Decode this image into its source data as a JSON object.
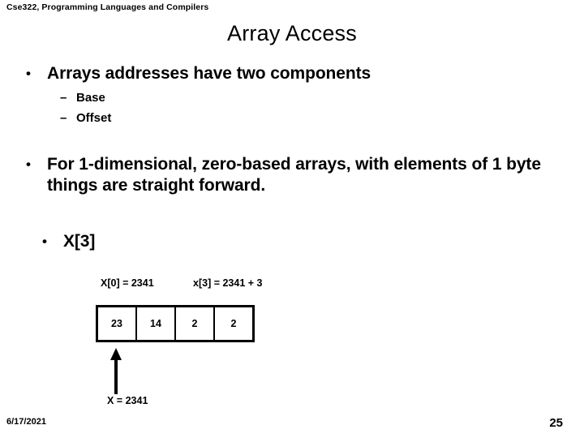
{
  "slide": {
    "header": "Cse322, Programming Languages and Compilers",
    "title": "Array Access",
    "background_color": "#ffffff",
    "text_color": "#000000",
    "bullets": [
      {
        "level": 1,
        "marker": "•",
        "text": "Arrays addresses have two components"
      },
      {
        "level": 2,
        "marker": "–",
        "text": "Base"
      },
      {
        "level": 2,
        "marker": "–",
        "text": "Offset"
      },
      {
        "level": 1,
        "marker": "•",
        "text": "For 1-dimensional, zero-based arrays, with elements of 1 byte things are straight forward."
      },
      {
        "level": 1,
        "marker": "•",
        "text": "X[3]"
      }
    ],
    "diagram": {
      "label_left": "X[0] = 2341",
      "label_right": "x[3] = 2341 + 3",
      "cells": [
        "23",
        "14",
        "2",
        "2"
      ],
      "arrow_icon": "up-arrow-icon",
      "base_label": "X = 2341"
    },
    "footer": {
      "date": "6/17/2021",
      "page_number": "25"
    }
  }
}
